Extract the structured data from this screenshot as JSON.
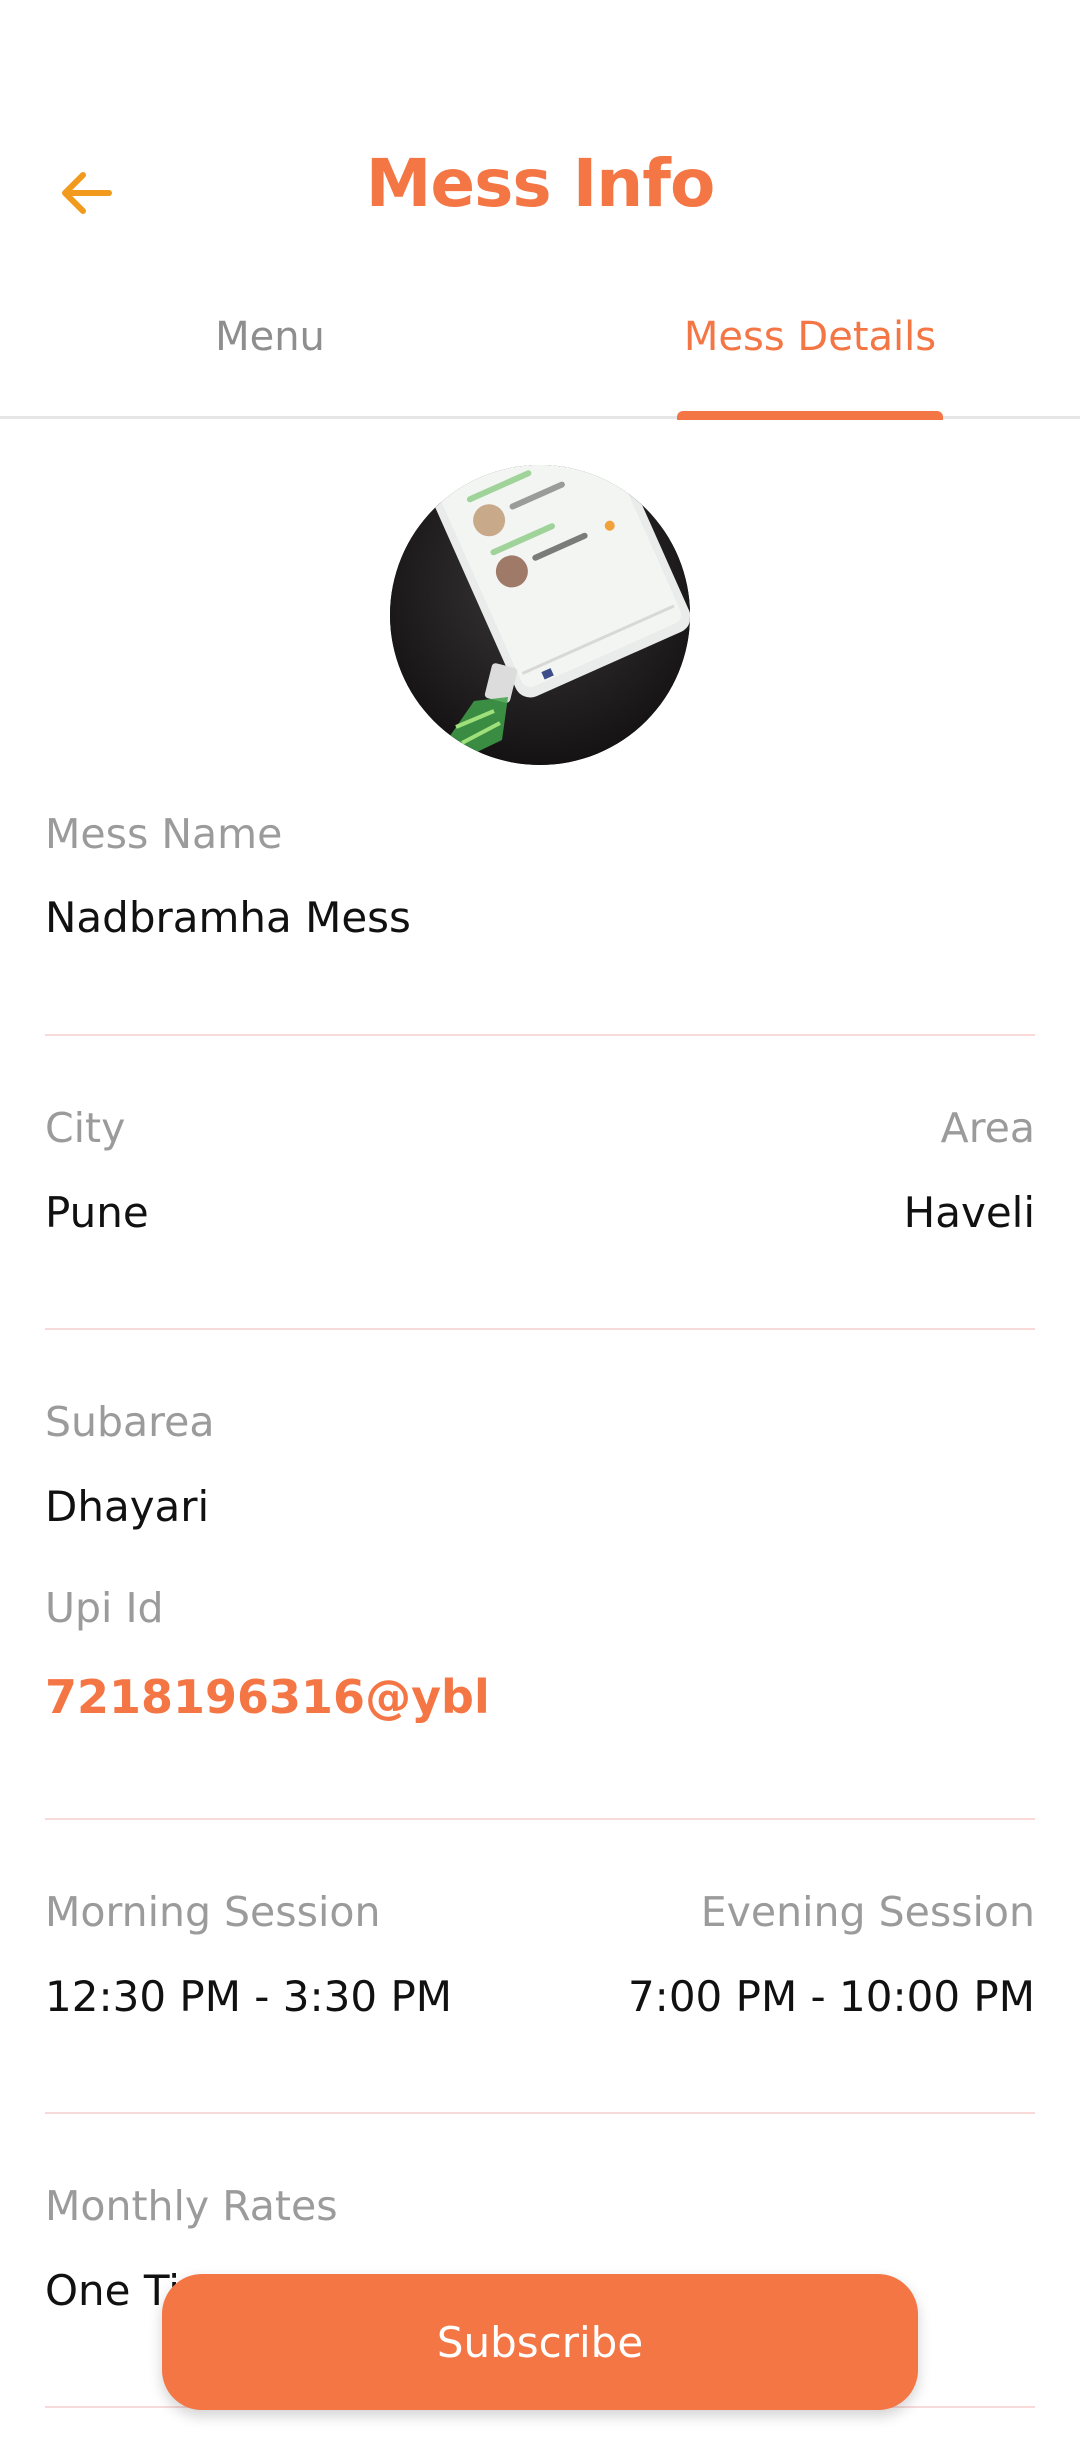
{
  "header": {
    "title": "Mess Info",
    "back_icon": "arrow-left-icon"
  },
  "tabs": [
    {
      "label": "Menu",
      "active": false
    },
    {
      "label": "Mess Details",
      "active": true
    }
  ],
  "colors": {
    "accent": "#F47645",
    "back_arrow": "#F29A1E",
    "label": "#9b9b9b",
    "divider": "#f9dada"
  },
  "details": {
    "mess_name": {
      "label": "Mess Name",
      "value": "Nadbramha Mess"
    },
    "city": {
      "label": "City",
      "value": "Pune"
    },
    "area": {
      "label": "Area",
      "value": "Haveli"
    },
    "subarea": {
      "label": "Subarea",
      "value": "Dhayari"
    },
    "upi": {
      "label": "Upi Id",
      "value": "7218196316@ybl"
    },
    "morning": {
      "label": "Morning Session",
      "value": "12:30 PM - 3:30 PM"
    },
    "evening": {
      "label": "Evening Session",
      "value": "7:00 PM - 10:00 PM"
    },
    "monthly": {
      "label": "Monthly Rates",
      "value": "One Ti"
    }
  },
  "actions": {
    "subscribe_label": "Subscribe"
  }
}
